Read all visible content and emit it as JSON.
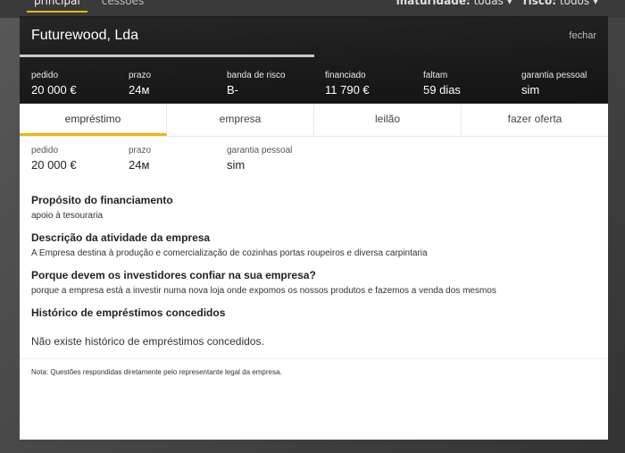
{
  "background": {
    "tabs": [
      "principal",
      "cessões"
    ],
    "filters": [
      {
        "label": "maturidade:",
        "value": "todas"
      },
      {
        "label": "risco:",
        "value": "todos"
      }
    ]
  },
  "modal": {
    "company_name": "Futurewood, Lda",
    "close_label": "fechar",
    "stats": [
      {
        "label": "pedido",
        "value": "20 000 €"
      },
      {
        "label": "prazo",
        "value": "24м"
      },
      {
        "label": "banda de risco",
        "value": "B-"
      },
      {
        "label": "financiado",
        "value": "11 790 €"
      },
      {
        "label": "faltam",
        "value": "59 dias"
      },
      {
        "label": "garantia pessoal",
        "value": "sim"
      }
    ],
    "tabs": [
      {
        "label": "empréstimo",
        "active": true
      },
      {
        "label": "empresa",
        "active": false
      },
      {
        "label": "leilão",
        "active": false
      },
      {
        "label": "fazer oferta",
        "active": false
      }
    ],
    "summary": [
      {
        "label": "pedido",
        "value": "20 000 €"
      },
      {
        "label": "prazo",
        "value": "24м"
      },
      {
        "label": "garantia pessoal",
        "value": "sim"
      }
    ],
    "sections": [
      {
        "title": "Propósito do financiamento",
        "text": "apoio à tesouraria"
      },
      {
        "title": "Descrição da atividade da empresa",
        "text": "A Empresa destina à produção e comercialização de cozinhas portas roupeiros e diversa carpintaria"
      },
      {
        "title": "Porque devem os investidores confiar na sua empresa?",
        "text": "porque a empresa está a investir numa nova loja onde expomos os nossos produtos e fazemos a venda dos mesmos"
      },
      {
        "title": "Histórico de empréstimos concedidos",
        "text": ""
      }
    ],
    "empty_history": "Não existe histórico de empréstimos concedidos.",
    "note": "Nota: Questões respondidas diretamente pelo representante legal da empresa."
  },
  "colors": {
    "accent": "#f2b705"
  }
}
